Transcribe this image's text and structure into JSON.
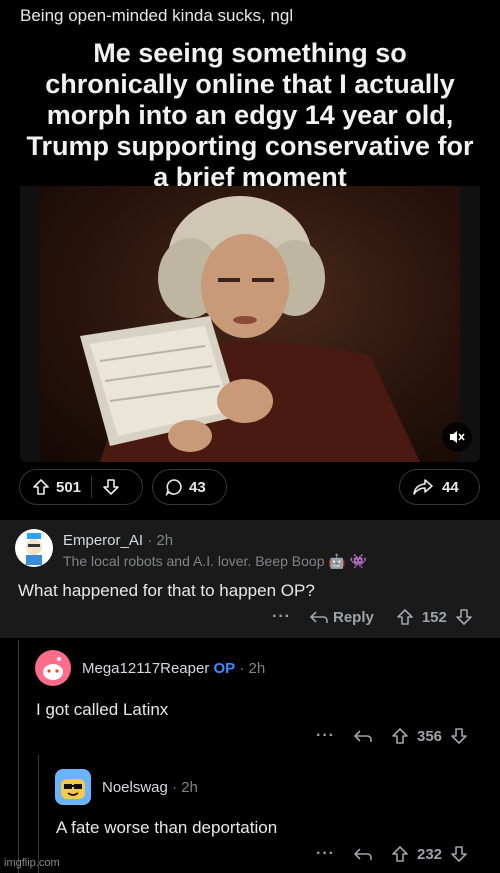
{
  "post": {
    "title": "Being open-minded kinda sucks, ngl",
    "meme_caption": "Me seeing something so chronically online that I actually morph into an edgy 14 year old, Trump supporting conservative for a brief moment",
    "upvotes": "501",
    "comments": "43",
    "shares": "44"
  },
  "comments": [
    {
      "author": "Emperor_AI",
      "time": "2h",
      "flair": "The local robots and A.I. lover. Beep Boop 🤖 👾",
      "body": "What happened for that to happen OP?",
      "reply_label": "Reply",
      "votes": "152"
    },
    {
      "author": "Mega12117Reaper",
      "op_tag": "OP",
      "time": "2h",
      "body": "I got called Latinx",
      "votes": "356"
    },
    {
      "author": "Noelswag",
      "time": "2h",
      "body": "A fate worse than deportation",
      "votes": "232"
    }
  ],
  "icons": [
    "upvote-icon",
    "downvote-icon",
    "comment-icon",
    "share-icon",
    "mute-icon",
    "more-icon",
    "reply-icon"
  ],
  "watermark": "imgflip.com",
  "colors": {
    "background": "#000000",
    "comment_bg": "#1a1a1b",
    "op_blue": "#3d8bff",
    "meta": "#818384"
  }
}
